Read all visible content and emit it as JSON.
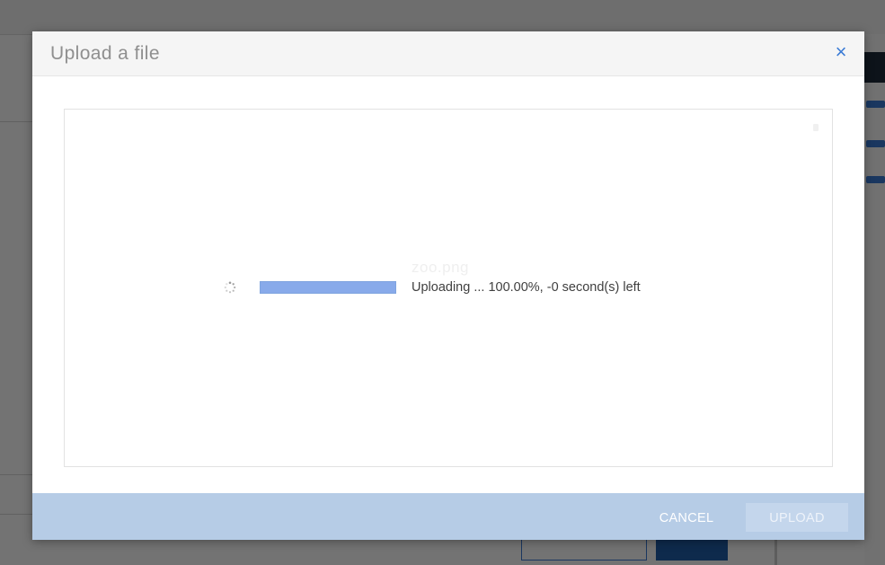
{
  "dialog": {
    "title": "Upload a file",
    "close_label": "×"
  },
  "upload": {
    "file_name": "zoo.png",
    "status_text": "Uploading ... 100.00%, -0 second(s) left",
    "progress_percent": 100
  },
  "footer": {
    "cancel_label": "CANCEL",
    "upload_label": "UPLOAD"
  },
  "colors": {
    "accent": "#3a7bd5",
    "progress_fill": "#88aaea",
    "footer_bg": "#b6cce6"
  },
  "icons": {
    "close": "close-icon",
    "spinner": "loading-spinner-icon"
  }
}
